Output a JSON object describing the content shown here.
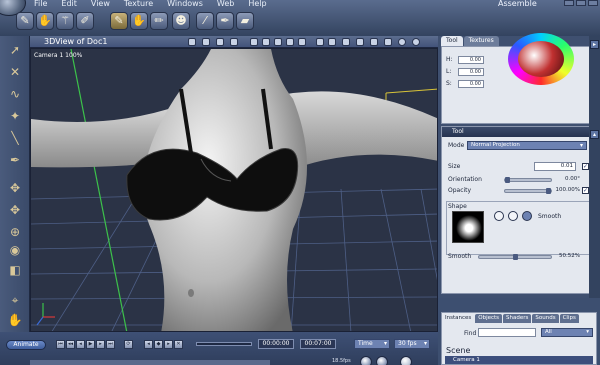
{
  "menu": [
    "File",
    "Edit",
    "View",
    "Texture",
    "Windows",
    "Web",
    "Help"
  ],
  "document_name": "Assemble",
  "toolbar": {
    "icons": [
      "paint-brush-icon",
      "hand-icon",
      "wand-icon",
      "tool-icon",
      "brush-active-icon",
      "smudge-icon",
      "pencil-icon",
      "figure-icon",
      "knife-icon",
      "pen-icon"
    ]
  },
  "viewport": {
    "title": "3DView of Doc1",
    "camera": "Camera 1 100%"
  },
  "right_tabs": [
    "Tool",
    "Textures"
  ],
  "color": {
    "h_label": "H:",
    "h": "0.00",
    "l_label": "L:",
    "l": "0.00",
    "s_label": "S:",
    "s": "0.00"
  },
  "tool_panel": {
    "title": "Tool",
    "mode_label": "Mode",
    "mode_value": "Normal Projection",
    "size_label": "Size",
    "size_value": "0.01",
    "orientation_label": "Orientation",
    "orientation_value": "0.00°",
    "orientation_level": 0.0,
    "opacity_label": "Opacity",
    "opacity_value": "100.00%",
    "opacity_level": 1.0,
    "shape_label": "Shape",
    "smooth_btn_label": "Smooth",
    "smooth_label": "Smooth",
    "smooth_value": "50.52%",
    "smooth_level": 0.5052
  },
  "library": {
    "tabs": [
      "Instances",
      "Objects",
      "Shaders",
      "Sounds",
      "Clips"
    ],
    "find_label": "Find",
    "find_value": "",
    "filter_value": "All",
    "scene_label": "Scene",
    "scene_item": "Camera 1"
  },
  "transport": {
    "animate_label": "Animate",
    "time_current": "00:00:00",
    "time_end": "00:07:00",
    "time_mode": "Time",
    "fps": "30 fps",
    "fps_readout": "18.5fps"
  },
  "colors": {
    "ui_dark": "#3d4f70",
    "viewport_bg": "#2b3346",
    "panel_bg": "#e4e8ef",
    "accent_blue": "#6d82b2"
  }
}
